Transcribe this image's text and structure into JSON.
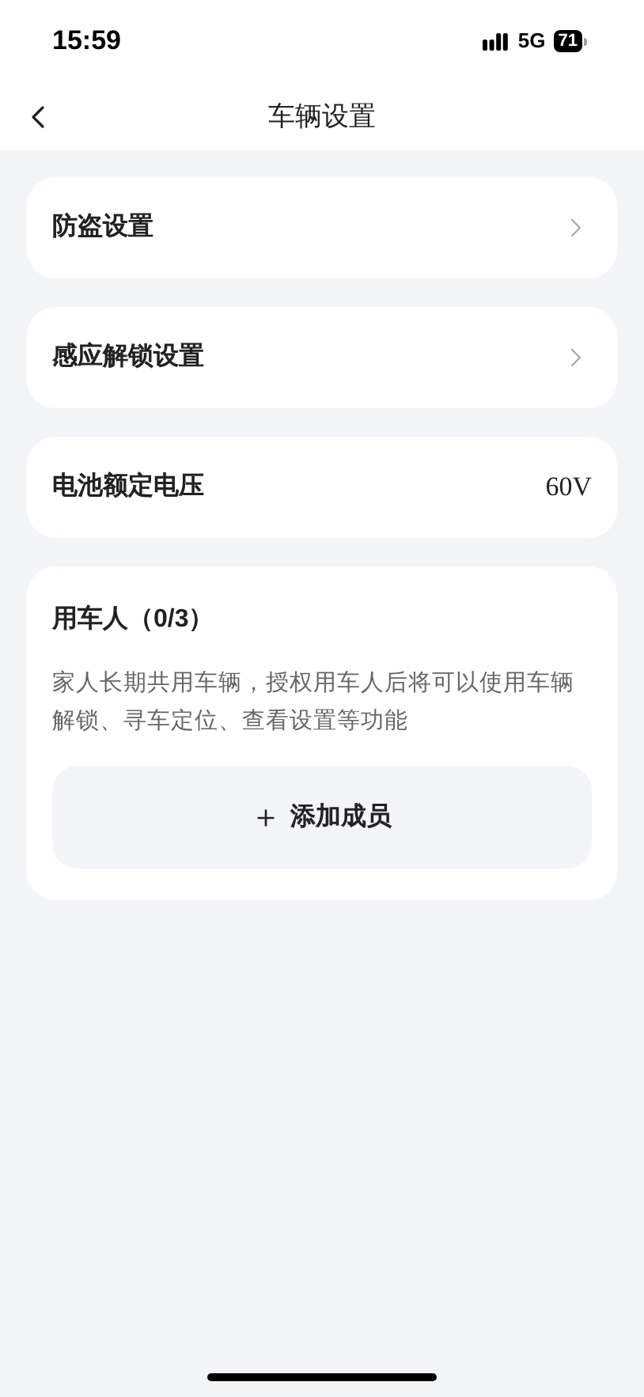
{
  "status_bar": {
    "time": "15:59",
    "network": "5G",
    "battery": "71"
  },
  "nav": {
    "title": "车辆设置"
  },
  "rows": [
    {
      "kind": "link",
      "label": "防盗设置"
    },
    {
      "kind": "link",
      "label": "感应解锁设置"
    },
    {
      "kind": "value",
      "label": "电池额定电压",
      "value": "60V"
    }
  ],
  "members": {
    "title": "用车人（0/3）",
    "description": "家人长期共用车辆，授权用车人后将可以使用车辆解锁、寻车定位、查看设置等功能",
    "add_button": "添加成员"
  }
}
